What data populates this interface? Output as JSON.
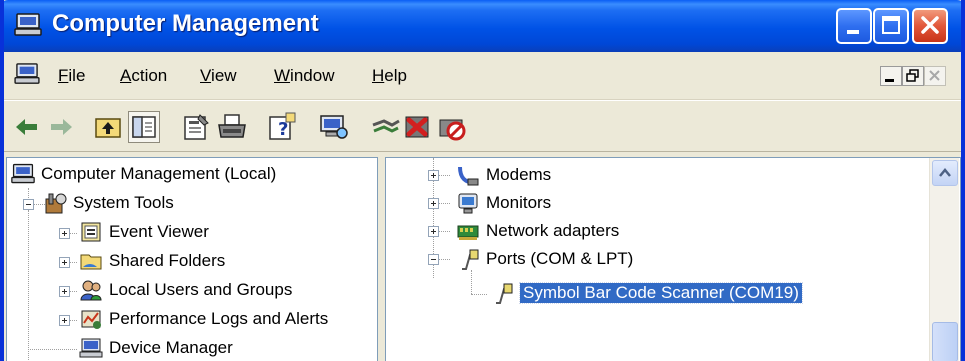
{
  "window": {
    "title": "Computer Management",
    "title_icon": "computer-management-icon",
    "controls": [
      "minimize-icon",
      "maximize-icon",
      "close-icon"
    ]
  },
  "menubar": {
    "items": [
      {
        "label": "File",
        "accel": "F",
        "rest": "ile"
      },
      {
        "label": "Action",
        "accel": "A",
        "rest": "ction"
      },
      {
        "label": "View",
        "accel": "V",
        "rest": "iew"
      },
      {
        "label": "Window",
        "accel": "W",
        "rest": "indow"
      },
      {
        "label": "Help",
        "accel": "H",
        "rest": "elp"
      }
    ]
  },
  "toolbar": {
    "buttons": [
      "back-icon",
      "forward-icon",
      "up-folder-icon",
      "show-hide-tree-icon",
      "properties-icon",
      "print-icon",
      "help-icon",
      "scan-hardware-icon",
      "update-driver-icon",
      "uninstall-icon",
      "disable-icon"
    ]
  },
  "tree_left": {
    "root": "Computer Management (Local)",
    "system_tools": "System Tools",
    "children": [
      {
        "label": "Event Viewer",
        "icon": "event-viewer-icon"
      },
      {
        "label": "Shared Folders",
        "icon": "shared-folders-icon"
      },
      {
        "label": "Local Users and Groups",
        "icon": "local-users-icon"
      },
      {
        "label": "Performance Logs and Alerts",
        "icon": "performance-logs-icon"
      },
      {
        "label": "Device Manager",
        "icon": "device-manager-icon"
      }
    ]
  },
  "tree_right": {
    "items": [
      {
        "label": "Modems",
        "icon": "modem-icon"
      },
      {
        "label": "Monitors",
        "icon": "monitor-icon"
      },
      {
        "label": "Network adapters",
        "icon": "network-adapter-icon"
      },
      {
        "label": "Ports (COM & LPT)",
        "icon": "port-icon"
      }
    ],
    "selected_child": "Symbol Bar Code Scanner (COM19)"
  },
  "colors": {
    "titlebar": "#0052e6",
    "selection": "#316ac5",
    "chrome": "#ece9d8"
  }
}
